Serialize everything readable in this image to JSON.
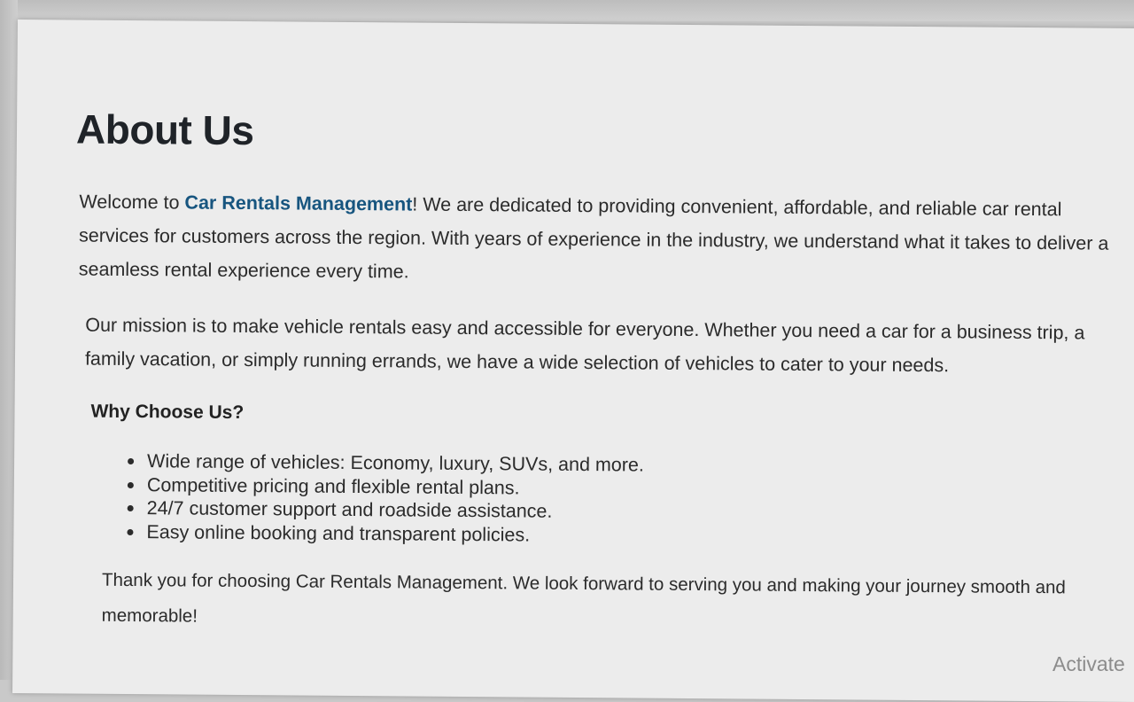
{
  "page": {
    "title": "About Us"
  },
  "intro": {
    "prefix": "Welcome to ",
    "brand": "Car Rentals Management",
    "suffix": "! We are dedicated to providing convenient, affordable, and reliable car rental services for customers across the region. With years of experience in the industry, we understand what it takes to deliver a seamless rental experience every time."
  },
  "mission": {
    "text": "Our mission is to make vehicle rentals easy and accessible for everyone. Whether you need a car for a business trip, a family vacation, or simply running errands, we have a wide selection of vehicles to cater to your needs."
  },
  "why_choose": {
    "heading": "Why Choose Us?",
    "items": [
      "Wide range of vehicles: Economy, luxury, SUVs, and more.",
      "Competitive pricing and flexible rental plans.",
      "24/7 customer support and roadside assistance.",
      "Easy online booking and transparent policies."
    ]
  },
  "closing": {
    "text": "Thank you for choosing Car Rentals Management. We look forward to serving you and making your journey smooth and memorable!"
  },
  "watermark": {
    "text": "Activate"
  },
  "colors": {
    "brand": "#17557f",
    "text": "#2b2b2b",
    "background": "#ececec"
  }
}
